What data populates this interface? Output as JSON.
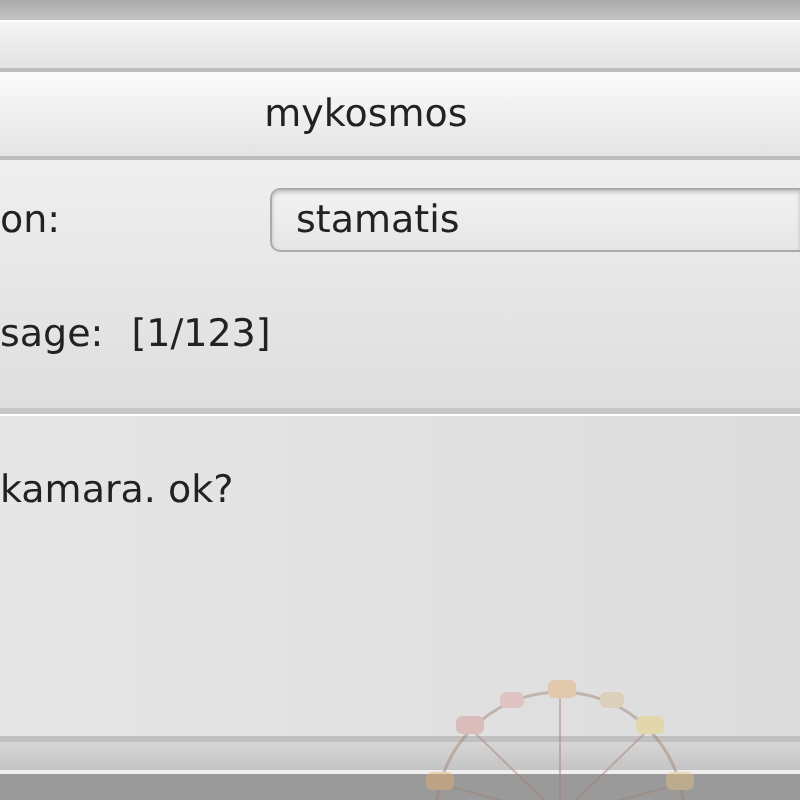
{
  "window": {
    "title": "mykosmos"
  },
  "form": {
    "recipient_label": "on:",
    "recipient_value": "stamatis",
    "message_label": "sage:",
    "message_counter": "[1/123]"
  },
  "message": {
    "text": "kamara. ok?"
  }
}
